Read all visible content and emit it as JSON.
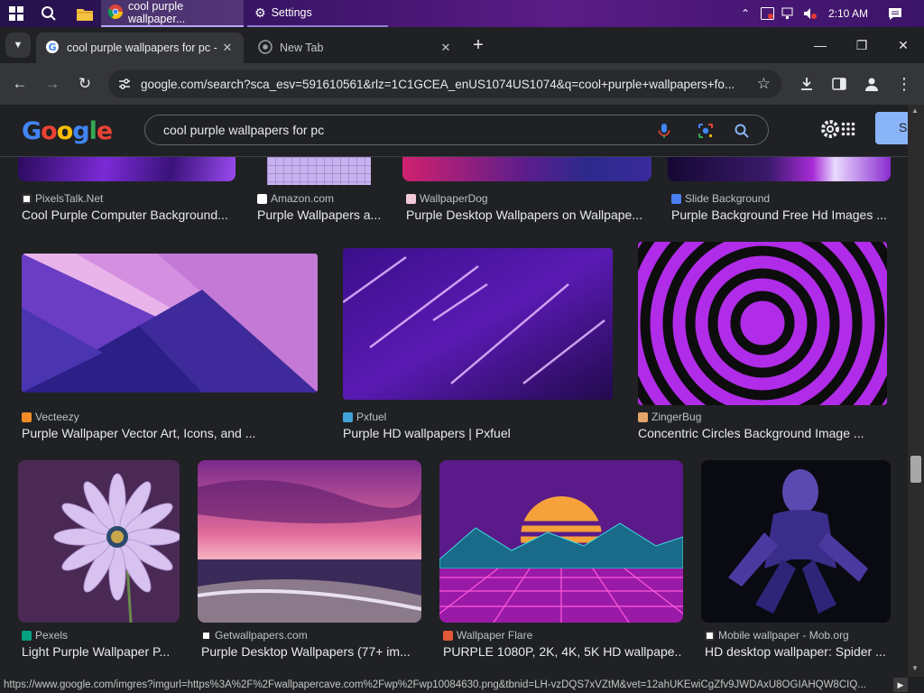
{
  "taskbar": {
    "tasks": [
      {
        "label": "cool purple wallpaper..."
      },
      {
        "label": "Settings"
      }
    ],
    "time": "2:10 AM"
  },
  "tabs": [
    {
      "title": "cool purple wallpapers for pc - G"
    },
    {
      "title": "New Tab"
    }
  ],
  "toolbar": {
    "url": "google.com/search?sca_esv=591610561&rlz=1C1GCEA_enUS1074US1074&q=cool+purple+wallpapers+fo..."
  },
  "google": {
    "logo": "Google",
    "query": "cool purple wallpapers for pc",
    "signin_label": "Si"
  },
  "results": {
    "row1": [
      {
        "source": "PixelsTalk.Net",
        "title": "Cool Purple Computer Background..."
      },
      {
        "source": "Amazon.com",
        "title": "Purple Wallpapers a..."
      },
      {
        "source": "WallpaperDog",
        "title": "Purple Desktop Wallpapers on Wallpape..."
      },
      {
        "source": "Slide Background",
        "title": "Purple Background Free Hd Images ..."
      }
    ],
    "row2": [
      {
        "source": "Vecteezy",
        "title": "Purple Wallpaper Vector Art, Icons, and ..."
      },
      {
        "source": "Pxfuel",
        "title": "Purple HD wallpapers | Pxfuel"
      },
      {
        "source": "ZingerBug",
        "title": "Concentric Circles Background Image ..."
      }
    ],
    "row3": [
      {
        "source": "Pexels",
        "title": "Light Purple Wallpaper P..."
      },
      {
        "source": "Getwallpapers.com",
        "title": "Purple Desktop Wallpapers (77+ im..."
      },
      {
        "source": "Wallpaper Flare",
        "title": "PURPLE 1080P, 2K, 4K, 5K HD wallpape..."
      },
      {
        "source": "Mobile wallpaper - Mob.org",
        "title": "HD desktop wallpaper: Spider ..."
      }
    ]
  },
  "status_url": "https://www.google.com/imgres?imgurl=https%3A%2F%2Fwallpapercave.com%2Fwp%2Fwp10084630.png&tbnid=LH-vzDQS7xVZtM&vet=12ahUKEwiCgZfv9JWDAxU8OGIAHQW8CIQ...",
  "colors": {
    "accent": "#8ab4f8",
    "taskbar": "#3a1466"
  }
}
